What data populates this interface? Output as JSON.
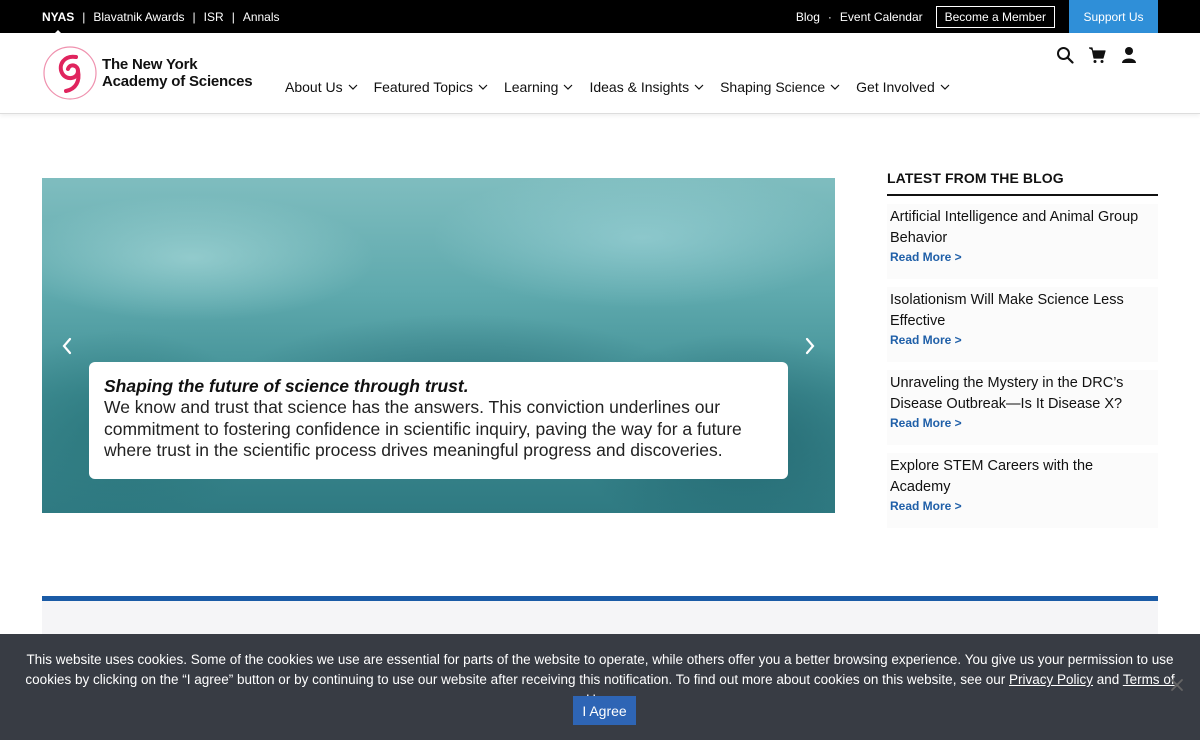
{
  "topbar": {
    "left_items": [
      "NYAS",
      "Blavatnik Awards",
      "ISR",
      "Annals"
    ],
    "blog": "Blog",
    "event_calendar": "Event Calendar",
    "become_member": "Become a Member",
    "support_us": "Support Us",
    "support_color": "#2f8fd8"
  },
  "header": {
    "logo_line1": "The New York",
    "logo_line2": "Academy of Sciences",
    "nav": [
      "About Us",
      "Featured Topics",
      "Learning",
      "Ideas & Insights",
      "Shaping Science",
      "Get Involved"
    ],
    "icons": [
      "search-icon",
      "cart-icon",
      "user-icon"
    ]
  },
  "hero": {
    "heading": "Shaping the future of science through trust.",
    "body": "We know and trust that science has the answers. This conviction underlines our commitment to fostering confidence in scientific inquiry, paving the way for a future where trust in the scientific process drives meaningful progress and discoveries."
  },
  "blog": {
    "title": "LATEST FROM THE BLOG",
    "read_more": "Read More >",
    "posts": [
      "Artificial Intelligence and Animal Group Behavior",
      "Isolationism Will Make Science Less Effective",
      "Unraveling the Mystery in the DRC’s Disease Outbreak—Is It Disease X?",
      "Explore STEM Careers with the Academy"
    ],
    "link_color": "#1f5fa8"
  },
  "cookie": {
    "text_before": "This website uses cookies. Some of the cookies we use are essential for parts of the website to operate, while others offer you a better browsing experience. You give us your permission to use cookies by clicking on the “I agree” button or by continuing to use our website after receiving this notification. To find out more about cookies on this website, see our ",
    "privacy_policy": "Privacy Policy",
    "and": " and ",
    "terms_of_use": "Terms of Use",
    "period": ".",
    "agree_button": "I Agree",
    "button_color": "#2e65b5"
  },
  "colors": {
    "accent_blue": "#1a5ba6",
    "logo_red": "#e0245e"
  }
}
